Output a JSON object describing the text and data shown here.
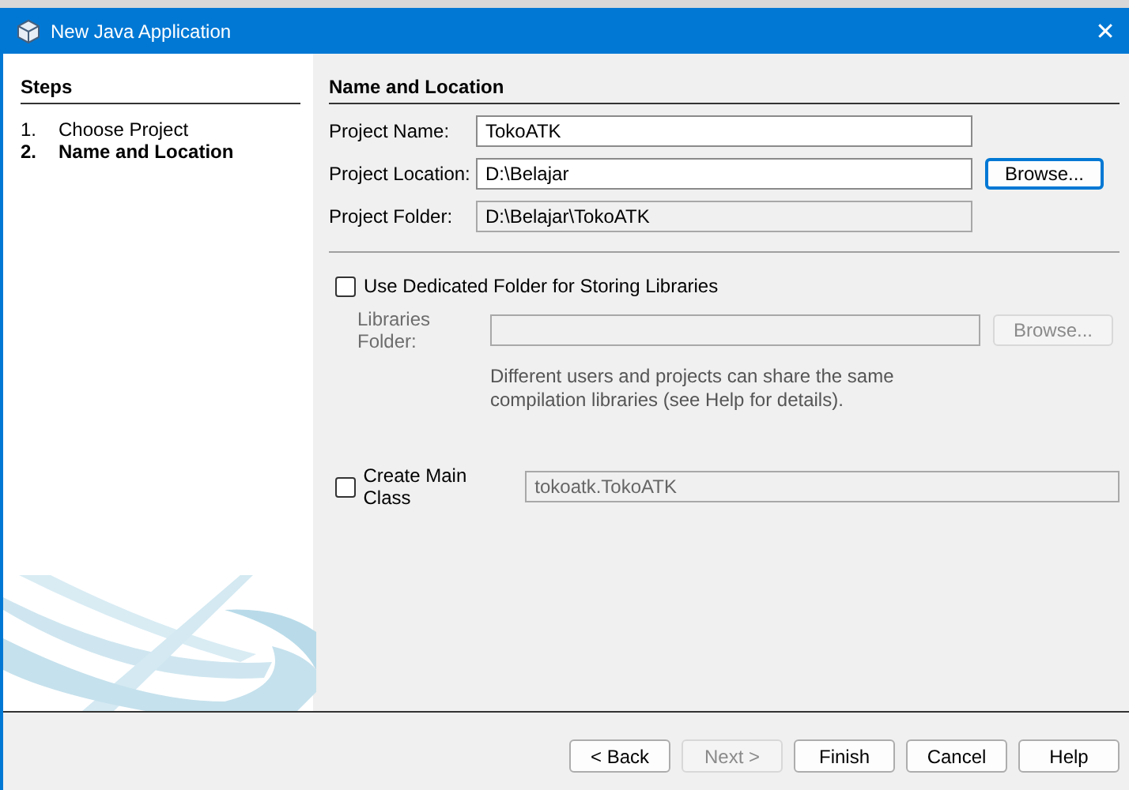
{
  "window": {
    "title": "New Java Application",
    "close": "✕"
  },
  "steps": {
    "heading": "Steps",
    "items": [
      {
        "number": "1.",
        "label": "Choose Project",
        "selected": false
      },
      {
        "number": "2.",
        "label": "Name and Location",
        "selected": true
      }
    ]
  },
  "panel": {
    "heading": "Name and Location",
    "fields": [
      {
        "label": "Project Name:",
        "value": "TokoATK",
        "readonly": false
      },
      {
        "label": "Project Location:",
        "value": "D:\\Belajar",
        "readonly": false,
        "button": {
          "label": "Browse...",
          "focused": true
        }
      },
      {
        "label": "Project Folder:",
        "value": "D:\\Belajar\\TokoATK",
        "readonly": true
      }
    ],
    "libraries": {
      "label": "Use Dedicated Folder for Storing Libraries",
      "checked": false,
      "folder_label": "Libraries Folder:",
      "button": "Browse...",
      "note": "Different users and projects can share the same compilation libraries (see Help for details)."
    },
    "main_class": {
      "label": "Create Main Class",
      "checked": false,
      "value": "tokoatk.TokoATK"
    }
  },
  "buttons": [
    {
      "label": "< Back",
      "disabled": false
    },
    {
      "label": "Next >",
      "disabled": true
    },
    {
      "label": "Finish",
      "disabled": false
    },
    {
      "label": "Cancel",
      "disabled": false
    },
    {
      "label": "Help",
      "disabled": false
    }
  ]
}
